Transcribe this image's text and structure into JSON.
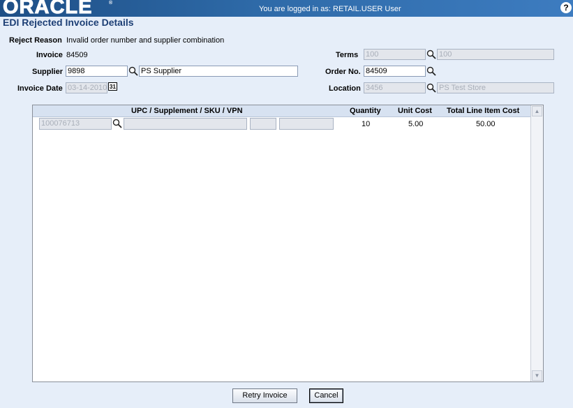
{
  "header": {
    "logo_text": "ORACLE",
    "logo_mark": "®",
    "login_info": "You are logged in as: RETAIL.USER User",
    "help_label": "?"
  },
  "page_title": "EDI Rejected Invoice Details",
  "reject": {
    "label": "Reject Reason",
    "value": "Invalid order number and supplier combination"
  },
  "invoice": {
    "label": "Invoice",
    "value": "84509"
  },
  "supplier": {
    "label": "Supplier",
    "id": "9898",
    "name": "PS Supplier"
  },
  "invoice_date": {
    "label": "Invoice Date",
    "value": "03-14-2010",
    "calendar_label": "31"
  },
  "terms": {
    "label": "Terms",
    "code": "100",
    "description": "100"
  },
  "order_no": {
    "label": "Order No.",
    "value": "84509"
  },
  "location": {
    "label": "Location",
    "id": "3456",
    "name": "PS Test Store"
  },
  "grid": {
    "columns": {
      "item": "UPC / Supplement / SKU / VPN",
      "quantity": "Quantity",
      "unit_cost": "Unit Cost",
      "total": "Total Line Item Cost"
    },
    "rows": [
      {
        "upc": "100076713",
        "supplement": "",
        "sku": "",
        "vpn": "",
        "quantity": "10",
        "unit_cost": "5.00",
        "total": "50.00"
      }
    ],
    "scroll_up": "▲",
    "scroll_down": "▼"
  },
  "buttons": {
    "retry": "Retry Invoice",
    "cancel": "Cancel"
  }
}
